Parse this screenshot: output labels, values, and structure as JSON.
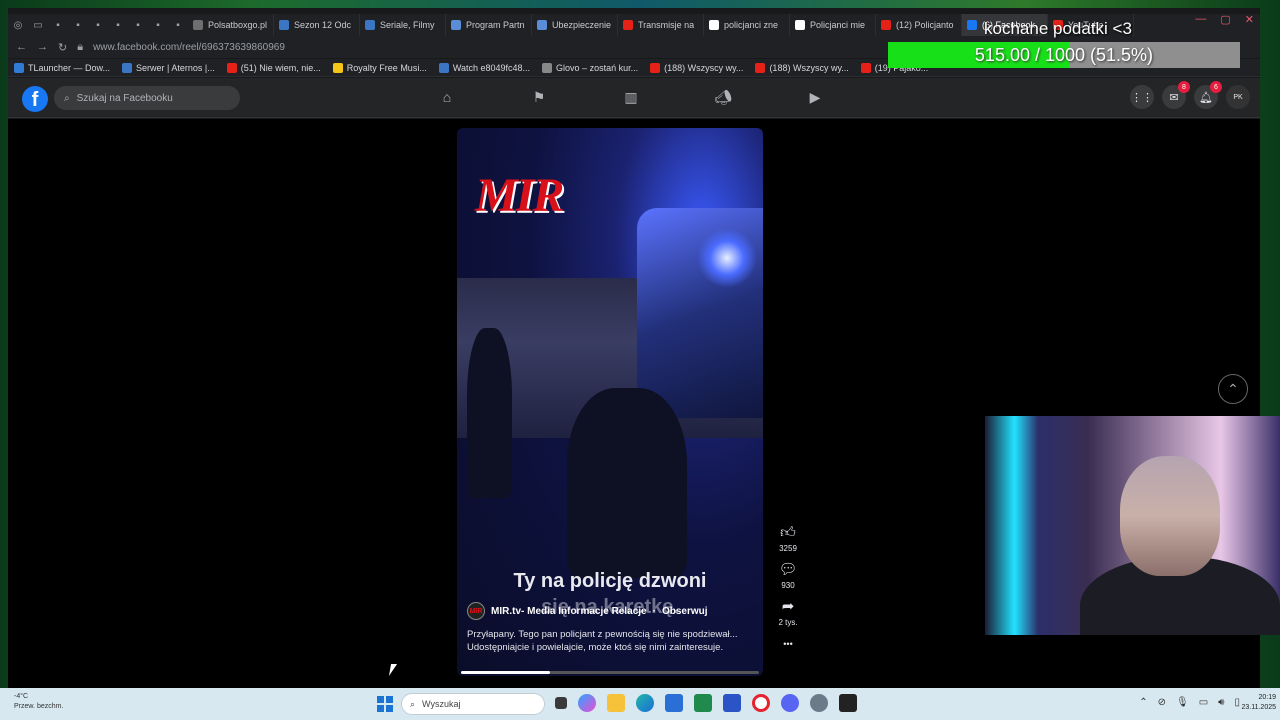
{
  "browser": {
    "tabs": [
      {
        "label": "Polsatboxgo.pl",
        "color": "#6f6f6f",
        "active": false
      },
      {
        "label": "Sezon 12 Odc",
        "color": "#3a76c4",
        "active": false
      },
      {
        "label": "Seriale, Filmy",
        "color": "#3a76c4",
        "active": false
      },
      {
        "label": "Program Partn",
        "color": "#5a8dd8",
        "active": false
      },
      {
        "label": "Ubezpieczenie",
        "color": "#5a8dd8",
        "active": false
      },
      {
        "label": "Transmisje na",
        "color": "#e62117",
        "active": false
      },
      {
        "label": "policjanci zne",
        "color": "#ffffff",
        "active": false
      },
      {
        "label": "Policjanci mie",
        "color": "#ffffff",
        "active": false
      },
      {
        "label": "(12) Policjanto",
        "color": "#e62117",
        "active": false
      },
      {
        "label": "(6) Facebook",
        "color": "#1877f2",
        "active": true
      },
      {
        "label": "YouTube",
        "color": "#e62117",
        "active": false
      }
    ],
    "url": "www.facebook.com/reel/696373639860969",
    "bookmarks": [
      {
        "label": "TLauncher — Dow...",
        "color": "#2f7bd6"
      },
      {
        "label": "Serwer | Aternos |...",
        "color": "#3a76c4"
      },
      {
        "label": "(51) Nie wiem, nie...",
        "color": "#e62117"
      },
      {
        "label": "Royalty Free Musi...",
        "color": "#f5c518"
      },
      {
        "label": "Watch e8049fc48...",
        "color": "#3a76c4"
      },
      {
        "label": "Glovo – zostań kur...",
        "color": "#888888"
      },
      {
        "label": "(188) Wszyscy wy...",
        "color": "#e62117"
      },
      {
        "label": "(188) Wszyscy wy...",
        "color": "#e62117"
      },
      {
        "label": "(19) Pajako...",
        "color": "#e62117"
      }
    ]
  },
  "facebook": {
    "search_placeholder": "Szukaj na Facebooku",
    "messenger_badge": "8",
    "notifications_badge": "6",
    "profile_initials": "PK"
  },
  "reel": {
    "logo_text": "MIR",
    "caption_line1": "Ty na policję dzwoni",
    "caption_line2": "się na karetkę.",
    "author": "MIR.tv- Media Informacje Relacje",
    "follow_label": "Obserwuj",
    "separator": "·",
    "description": "Przyłapany. Tego pan policjant z pewnością się nie spodziewał... Udostępniajcie i powielajcie, może ktoś się nimi zainteresuje.",
    "progress": 0.3,
    "likes": "3259",
    "comments": "930",
    "shares": "2 tys.",
    "more_label": "•••"
  },
  "stream": {
    "donation_title": "kochane podatki <3",
    "donation_text": "515.00 / 1000 (51.5%)",
    "donation_fraction": 0.515
  },
  "taskbar": {
    "weather_temp": "-4°C",
    "weather_desc": "Przew. bezchm.",
    "search_placeholder": "Wyszukaj",
    "time": "20:19",
    "date": "23.11.2025"
  }
}
